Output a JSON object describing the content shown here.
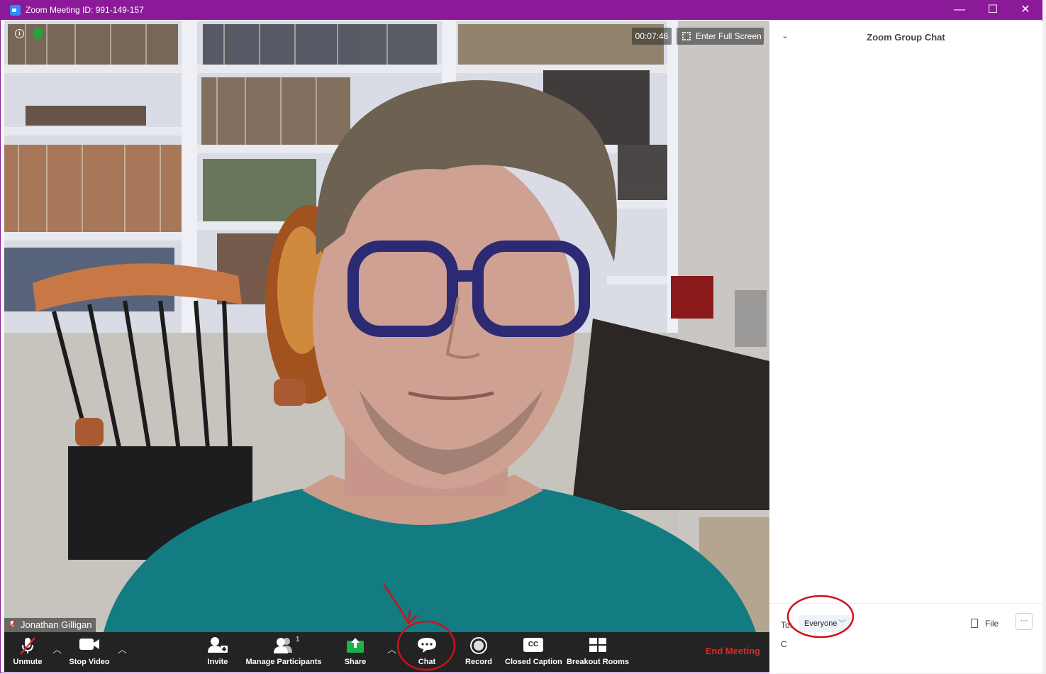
{
  "window": {
    "title": "Zoom Meeting ID: 991-149-157",
    "controls": {
      "minimize": "—",
      "maximize": "☐",
      "close": "✕"
    }
  },
  "video": {
    "timer": "00:07:46",
    "fullscreen_label": "Enter Full Screen",
    "participant_name": "Jonathan Gilligan"
  },
  "toolbar": {
    "unmute": "Unmute",
    "stop_video": "Stop Video",
    "invite": "Invite",
    "manage_participants": "Manage Participants",
    "participants_count": "1",
    "share": "Share",
    "chat": "Chat",
    "record": "Record",
    "closed_caption": "Closed Caption",
    "cc_icon_text": "CC",
    "breakout_rooms": "Breakout Rooms",
    "end_meeting": "End Meeting"
  },
  "chat": {
    "title": "Zoom Group Chat",
    "to_label": "To:",
    "recipient": "Everyone",
    "file_label": "File",
    "more_label": "···",
    "input_value": "C"
  },
  "colors": {
    "titlebar": "#8b1a99",
    "toolbar": "#232323",
    "end_meeting": "#e02828",
    "share_green": "#20b04b",
    "annotation_red": "#d0101a"
  }
}
